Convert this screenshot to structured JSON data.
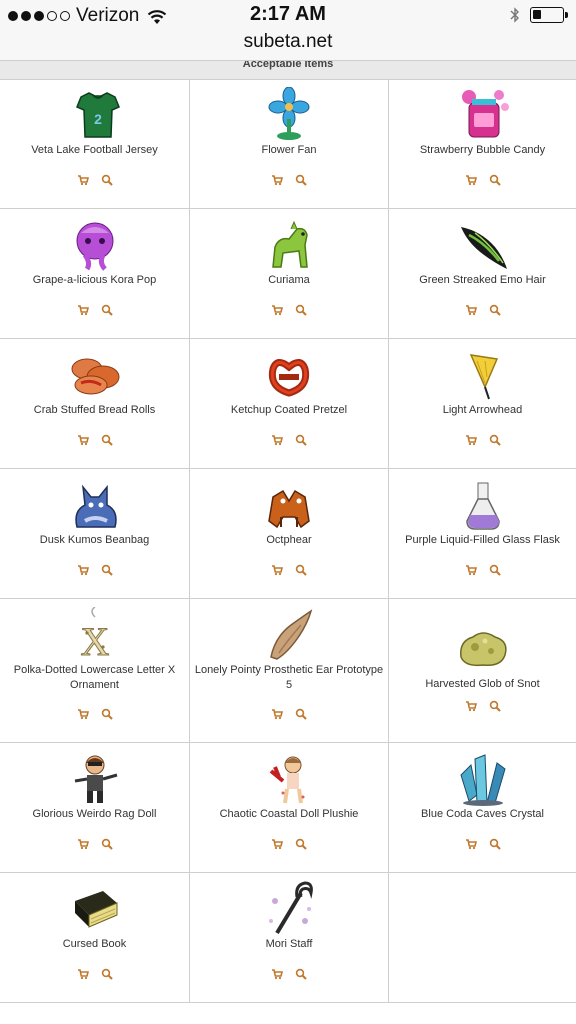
{
  "status_bar": {
    "carrier": "Verizon",
    "time": "2:17 AM",
    "battery_level": 0.3
  },
  "browser": {
    "url": "subeta.net"
  },
  "section": {
    "title": "Acceptable Items"
  },
  "colors": {
    "action": "#c0782c",
    "grid_line": "#cfcfcf",
    "header_bg": "#e9e9e9"
  },
  "items": [
    {
      "name": "Veta Lake Football Jersey",
      "icon": "jersey-icon"
    },
    {
      "name": "Flower Fan",
      "icon": "fan-icon"
    },
    {
      "name": "Strawberry Bubble Candy",
      "icon": "candy-jar-icon"
    },
    {
      "name": "Grape-a-licious Kora Pop",
      "icon": "kora-pop-icon"
    },
    {
      "name": "Curiama",
      "icon": "curiama-pet-icon"
    },
    {
      "name": "Green Streaked Emo Hair",
      "icon": "hair-icon"
    },
    {
      "name": "Crab Stuffed Bread Rolls",
      "icon": "bread-rolls-icon"
    },
    {
      "name": "Ketchup Coated Pretzel",
      "icon": "pretzel-icon"
    },
    {
      "name": "Light Arrowhead",
      "icon": "arrowhead-icon"
    },
    {
      "name": "Dusk Kumos Beanbag",
      "icon": "beanbag-icon"
    },
    {
      "name": "Octphear",
      "icon": "octphear-icon"
    },
    {
      "name": "Purple Liquid-Filled Glass Flask",
      "icon": "flask-icon"
    },
    {
      "name": "Polka-Dotted Lowercase Letter X Ornament",
      "icon": "letter-x-ornament-icon"
    },
    {
      "name": "Lonely Pointy Prosthetic Ear Prototype 5",
      "icon": "ear-icon"
    },
    {
      "name": "Harvested Glob of Snot",
      "icon": "snot-glob-icon"
    },
    {
      "name": "Glorious Weirdo Rag Doll",
      "icon": "rag-doll-icon"
    },
    {
      "name": "Chaotic Coastal Doll Plushie",
      "icon": "doll-plushie-icon"
    },
    {
      "name": "Blue Coda Caves Crystal",
      "icon": "crystal-icon"
    },
    {
      "name": "Cursed Book",
      "icon": "book-icon"
    },
    {
      "name": "Mori Staff",
      "icon": "staff-icon"
    }
  ]
}
